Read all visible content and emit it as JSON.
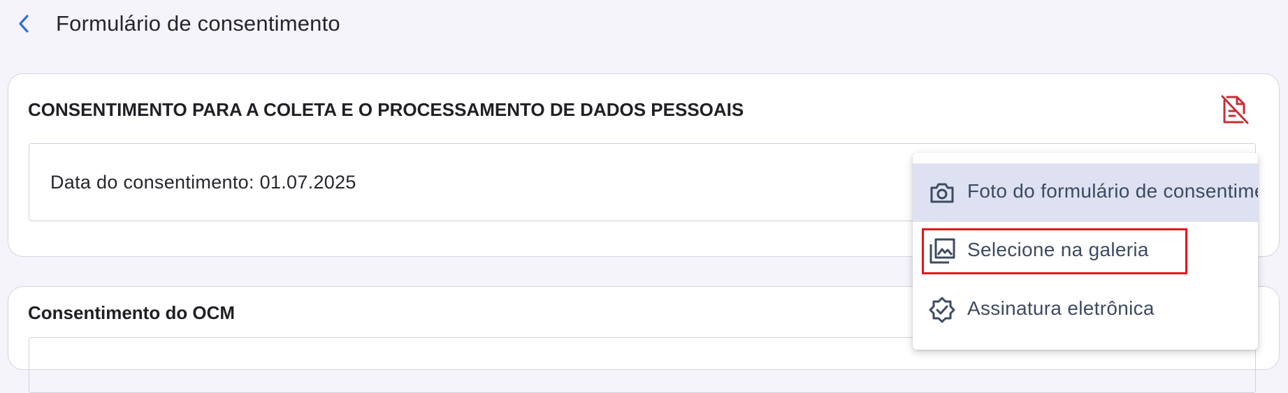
{
  "header": {
    "title": "Formulário de consentimento"
  },
  "consent_card": {
    "title": "CONSENTIMENTO PARA A COLETA E O PROCESSAMENTO DE DADOS PESSOAIS",
    "date_text": "Data do consentimento: 01.07.2025"
  },
  "ocm_card": {
    "title": "Consentimento do OCM"
  },
  "menu": {
    "items": [
      {
        "label": "Foto do formulário de consentimento",
        "icon": "camera-icon"
      },
      {
        "label": "Selecione na galeria",
        "icon": "gallery-icon"
      },
      {
        "label": "Assinatura eletrônica",
        "icon": "verified-badge-icon"
      }
    ]
  },
  "colors": {
    "accent": "#2f6fdd",
    "danger": "#c62f34",
    "highlight": "#e3161c",
    "menu_active": "#dde1f2"
  }
}
